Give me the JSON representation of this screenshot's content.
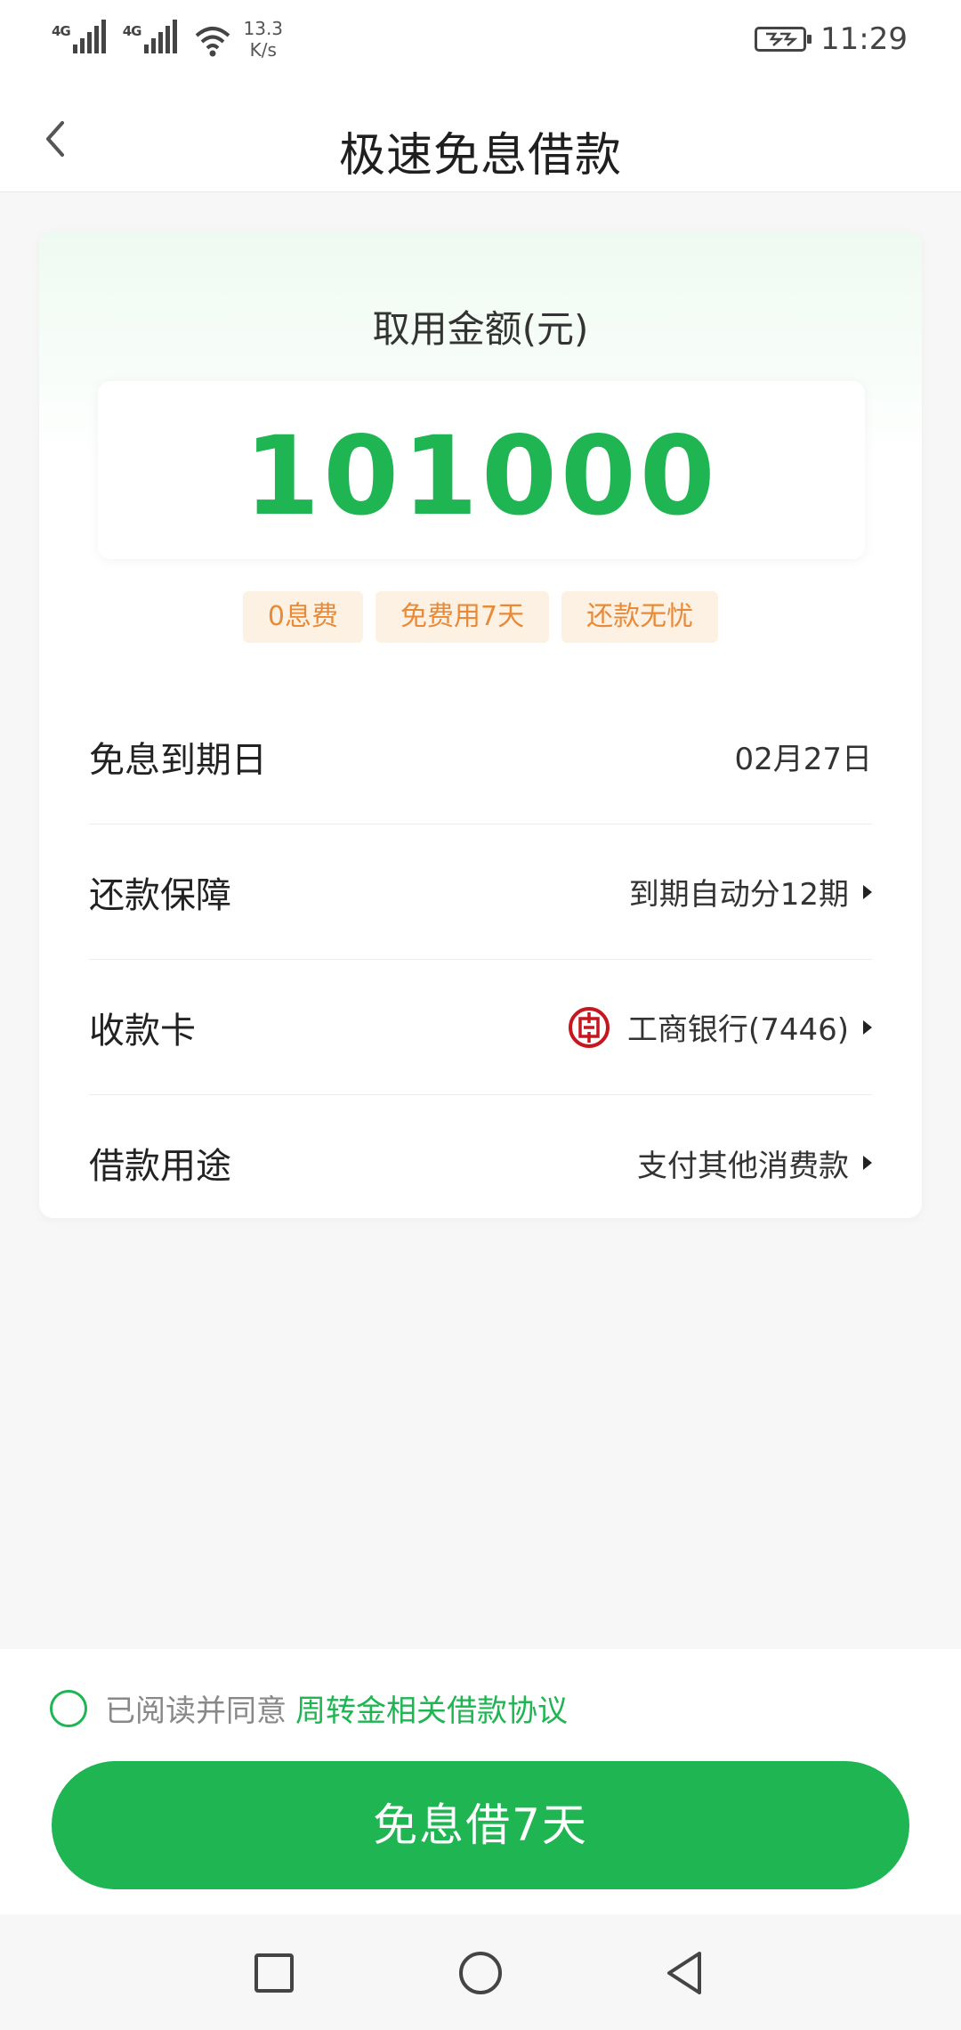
{
  "status_bar": {
    "net1": "4G",
    "net2": "4G",
    "speed_value": "13.3",
    "speed_unit": "K/s",
    "time": "11:29"
  },
  "nav": {
    "title": "极速免息借款"
  },
  "amount": {
    "label": "取用金额(元)",
    "value": "101000"
  },
  "tags": [
    "0息费",
    "免费用7天",
    "还款无忧"
  ],
  "rows": [
    {
      "label": "免息到期日",
      "value": "02月27日"
    },
    {
      "label": "还款保障",
      "value": "到期自动分12期"
    },
    {
      "label": "收款卡",
      "value": "工商银行(7446)"
    },
    {
      "label": "借款用途",
      "value": "支付其他消费款"
    }
  ],
  "agreement": {
    "prefix": "已阅读并同意",
    "link": "周转金相关借款协议"
  },
  "cta": {
    "label": "免息借7天"
  },
  "colors": {
    "accent_green": "#1fb552",
    "tag_bg": "#fdf1e3",
    "tag_text": "#e88a37",
    "bank_red": "#c7161e"
  }
}
